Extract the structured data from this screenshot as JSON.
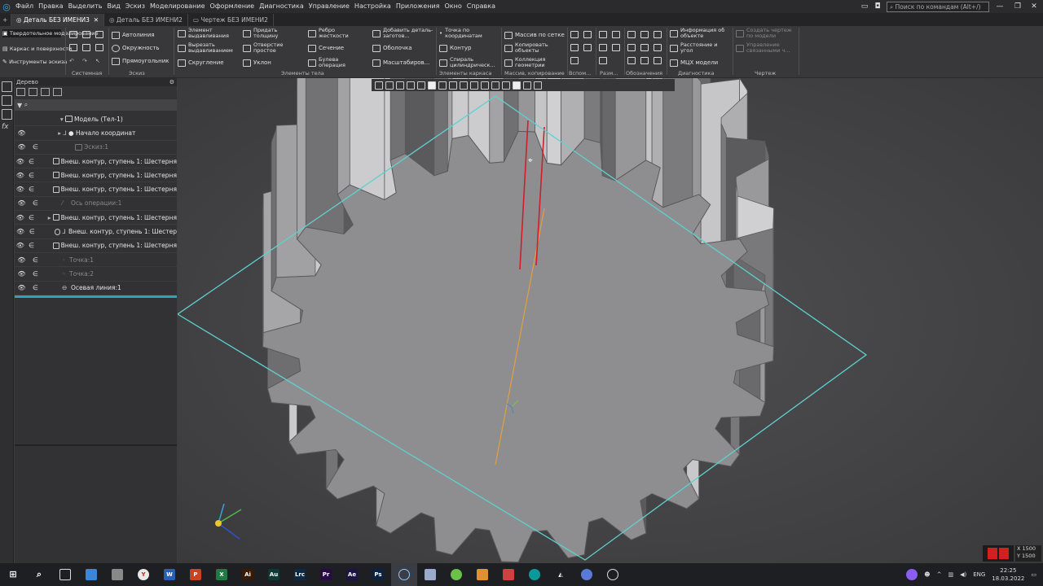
{
  "menu": [
    "Файл",
    "Правка",
    "Выделить",
    "Вид",
    "Эскиз",
    "Моделирование",
    "Оформление",
    "Диагностика",
    "Управление",
    "Настройка",
    "Приложения",
    "Окно",
    "Справка"
  ],
  "search": {
    "placeholder": "Поиск по командам (Alt+/)"
  },
  "tabs": [
    "Деталь БЕЗ ИМЕНИ3",
    "Деталь БЕЗ ИМЕНИ2",
    "Чертеж БЕЗ ИМЕНИ2"
  ],
  "ribbon": {
    "modes": [
      "Твердотельное моделирование",
      "Каркас и поверхности",
      "Инструменты эскиза"
    ],
    "sketch": [
      "Автолиния",
      "Окружность",
      "Прямоугольник"
    ],
    "body_col1": [
      "Элемент выдавливания",
      "Вырезать выдавливанием",
      "Скругление"
    ],
    "body_col2": [
      "Придать толщину",
      "Отверстие простое",
      "Уклон"
    ],
    "body_col3": [
      "Ребро жесткости",
      "Сечение",
      "Булева операция"
    ],
    "body_col4": [
      "Добавить деталь-заготов...",
      "Оболочка",
      "Масштабиров..."
    ],
    "frame": [
      "Точка по координатам",
      "Контур",
      "Спираль цилиндрическ..."
    ],
    "copy": [
      "Массив по сетке",
      "Копировать объекты",
      "Коллекция геометрии"
    ],
    "diag": [
      "Информация об объекте",
      "Расстояние и угол",
      "МЦХ модели"
    ],
    "drawing": [
      "Создать чертеж по модели",
      "Управление связанными ч..."
    ],
    "captions": [
      "Системная",
      "Эскиз",
      "Элементы тела",
      "Элементы каркаса",
      "Массив, копирование",
      "Вспом...",
      "Разм...",
      "Обозначения",
      "Диагностика",
      "Чертеж"
    ]
  },
  "tree": {
    "title": "Дерево",
    "rows": [
      {
        "label": "Модель (Тел-1)",
        "dim": false,
        "eye": false
      },
      {
        "label": "Начало координат",
        "dim": false,
        "eye": true
      },
      {
        "label": "Эскиз:1",
        "dim": true,
        "eye": true
      },
      {
        "label": "Внеш. контур, ступень 1: Шестерня",
        "dim": false,
        "eye": true
      },
      {
        "label": "Внеш. контур, ступень 1: Шестерня",
        "dim": false,
        "eye": true
      },
      {
        "label": "Внеш. контур, ступень 1: Шестерня",
        "dim": false,
        "eye": true
      },
      {
        "label": "Ось операции:1",
        "dim": true,
        "eye": true
      },
      {
        "label": "Внеш. контур, ступень 1: Шестерня",
        "dim": false,
        "eye": true
      },
      {
        "label": "Внеш. контур, ступень 1: Шестер",
        "dim": false,
        "eye": true
      },
      {
        "label": "Внеш. контур, ступень 1: Шестерня",
        "dim": false,
        "eye": true
      },
      {
        "label": "Точка:1",
        "dim": true,
        "eye": true
      },
      {
        "label": "Точка:2",
        "dim": true,
        "eye": true
      },
      {
        "label": "Осевая линия:1",
        "dim": false,
        "eye": true
      }
    ]
  },
  "coords": {
    "x": "X 1500",
    "y": "Y 1500"
  },
  "clock": {
    "time": "22:25",
    "date": "18.03.2022"
  },
  "lang": "ENG",
  "taskbar_apps": [
    {
      "name": "yandex",
      "color": "#e8e8e8",
      "glyph": "Y"
    },
    {
      "name": "word",
      "color": "#2b5fb4",
      "glyph": "W"
    },
    {
      "name": "powerpoint",
      "color": "#c8431f",
      "glyph": "P"
    },
    {
      "name": "excel",
      "color": "#1f7a43",
      "glyph": "X"
    },
    {
      "name": "illustrator",
      "color": "#3a1a00",
      "glyph": "Ai"
    },
    {
      "name": "audition",
      "color": "#0e3a36",
      "glyph": "Au"
    },
    {
      "name": "lrc",
      "color": "#0d2a45",
      "glyph": "Lrc"
    },
    {
      "name": "premiere",
      "color": "#2a0a44",
      "glyph": "Pr"
    },
    {
      "name": "after-effects",
      "color": "#1f1244",
      "glyph": "Ae"
    },
    {
      "name": "photoshop",
      "color": "#0a2344",
      "glyph": "Ps"
    }
  ],
  "colors": {
    "plane": "#5fd0d0",
    "axis": "#e0a040",
    "edge": "#d01e2a",
    "gear": "#8f8f91"
  }
}
